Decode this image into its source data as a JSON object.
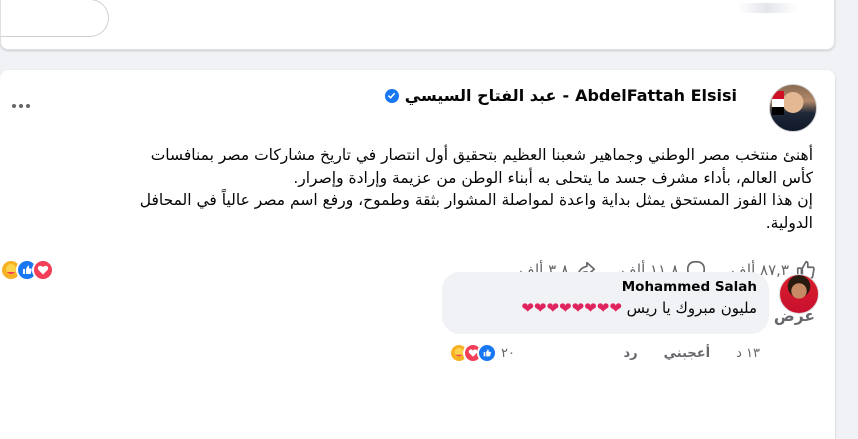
{
  "post": {
    "author_en": "AbdelFattah Elsisi",
    "separator": "-",
    "author_ar": "عبد الفتاح السيسي",
    "text_lines": [
      "أهنئ منتخب مصر الوطني وجماهير شعبنا العظيم بتحقيق أول انتصار في تاريخ مشاركات مصر بمنافسات",
      "كأس العالم، بأداء مشرف جسد ما يتحلى به أبناء الوطن من عزيمة وإرادة وإصرار.",
      "إن هذا الفوز المستحق يمثل بداية واعدة لمواصلة المشوار بثقة وطموح، ورفع اسم مصر عالياً في المحافل",
      "الدولية."
    ],
    "likes_count": "٨٧,٣ ألف",
    "comments_count": "١١,٨ ألف",
    "shares_count": "٣,٨ ألف",
    "reactions": [
      "love",
      "like",
      "care"
    ]
  },
  "comments_section": {
    "more_comments_label": "عرض المزيد من التعليقات"
  },
  "comment": {
    "author": "Mohammed Salah",
    "text": "مليون مبروك يا ريس",
    "hearts": "❤❤❤❤❤❤❤❤",
    "time": "١٣ د",
    "like_label": "أعجبني",
    "reply_label": "رد",
    "reactions_count": "٢٠",
    "reactions": [
      "care",
      "love",
      "like"
    ]
  },
  "colors": {
    "accent": "#1877f2",
    "love": "#f33e58",
    "care": "#f7b125",
    "muted": "#65676b",
    "background": "#f0f2f5"
  }
}
